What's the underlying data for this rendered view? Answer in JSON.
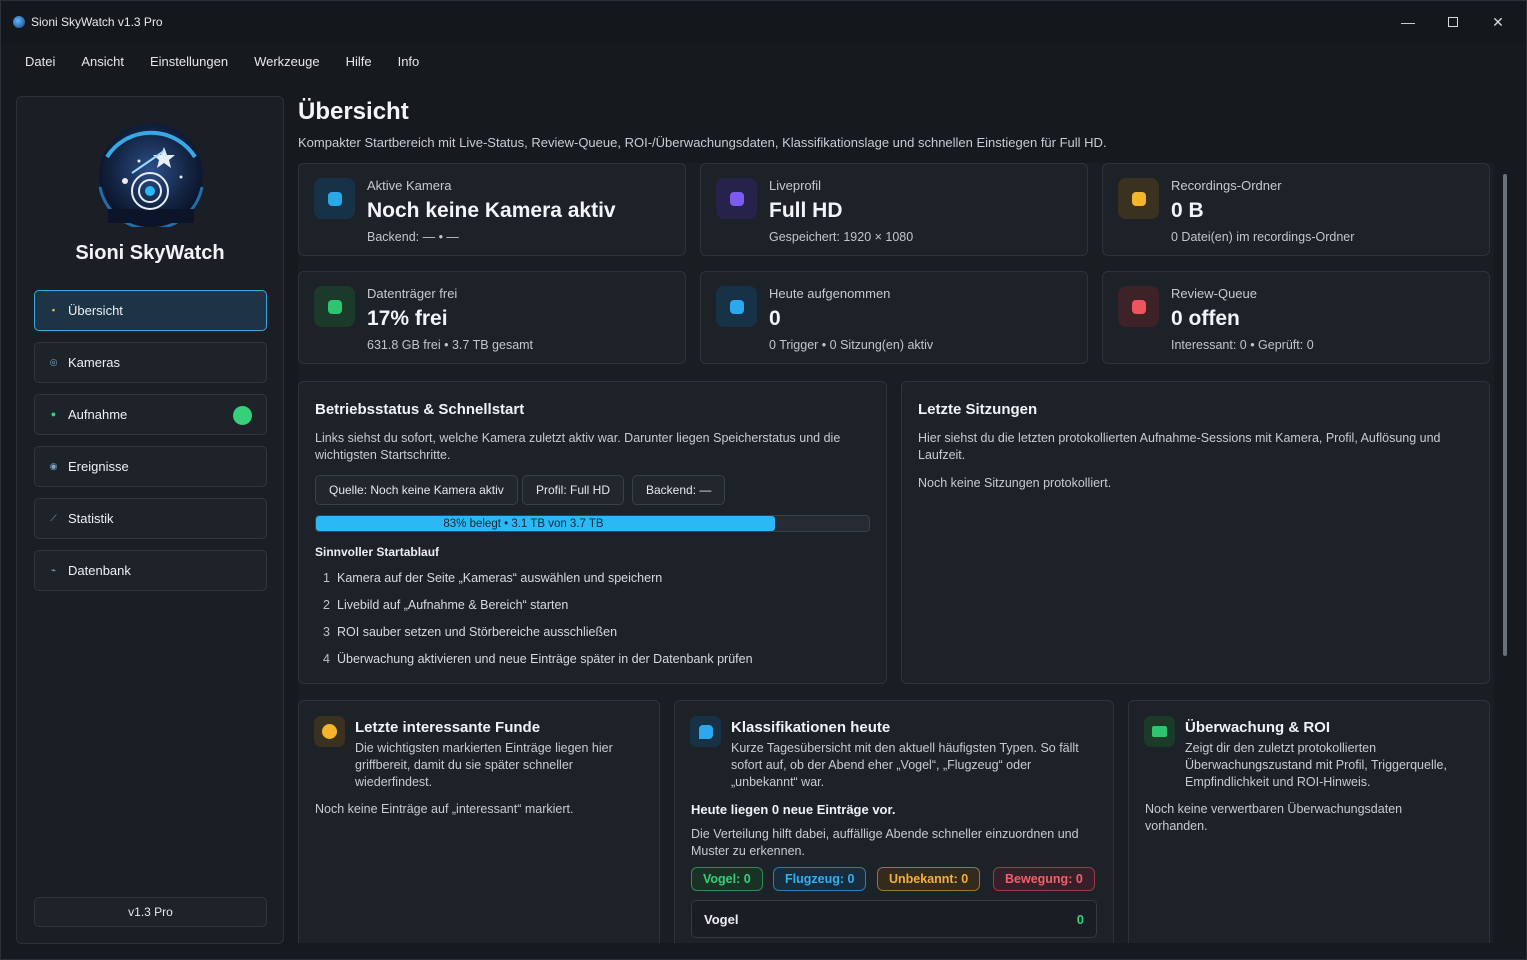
{
  "window": {
    "title": "Sioni SkyWatch v1.3 Pro"
  },
  "menu": [
    "Datei",
    "Ansicht",
    "Einstellungen",
    "Werkzeuge",
    "Hilfe",
    "Info"
  ],
  "sidebar": {
    "brand": "Sioni SkyWatch",
    "items": [
      {
        "label": "Übersicht",
        "icon": "grid-icon",
        "active": true
      },
      {
        "label": "Kameras",
        "icon": "camera-icon",
        "active": false
      },
      {
        "label": "Aufnahme",
        "icon": "record-icon",
        "active": false,
        "live": true
      },
      {
        "label": "Ereignisse",
        "icon": "events-icon",
        "active": false
      },
      {
        "label": "Statistik",
        "icon": "chart-icon",
        "active": false
      },
      {
        "label": "Datenbank",
        "icon": "database-icon",
        "active": false
      }
    ],
    "version": "v1.3 Pro"
  },
  "page": {
    "title": "Übersicht",
    "subtitle": "Kompakter Startbereich mit Live-Status, Review-Queue, ROI-/Überwachungsdaten, Klassifikationslage und schnellen Einstiegen für Full HD."
  },
  "stats": [
    {
      "label": "Aktive Kamera",
      "value": "Noch keine Kamera aktiv",
      "sub": "Backend: — • —",
      "color": "#29a9e8"
    },
    {
      "label": "Liveprofil",
      "value": "Full HD",
      "sub": "Gespeichert: 1920 × 1080",
      "color": "#7c5cf0"
    },
    {
      "label": "Recordings-Ordner",
      "value": "0 B",
      "sub": "0 Datei(en) im recordings-Ordner",
      "color": "#f2b52c"
    },
    {
      "label": "Datenträger frei",
      "value": "17% frei",
      "sub": "631.8 GB frei • 3.7 TB gesamt",
      "color": "#2fc46f"
    },
    {
      "label": "Heute aufgenommen",
      "value": "0",
      "sub": "0 Trigger • 0 Sitzung(en) aktiv",
      "color": "#2ba8ee"
    },
    {
      "label": "Review-Queue",
      "value": "0 offen",
      "sub": "Interessant: 0 • Geprüft: 0",
      "color": "#ec5560"
    }
  ],
  "status": {
    "title": "Betriebsstatus & Schnellstart",
    "text": "Links siehst du sofort, welche Kamera zuletzt aktiv war. Darunter liegen Speicherstatus und die wichtigsten Startschritte.",
    "chips": [
      "Quelle: Noch keine Kamera aktiv",
      "Profil: Full HD",
      "Backend: —"
    ],
    "progress_text": "83% belegt • 3.1 TB von 3.7 TB",
    "progress_value": 0.83,
    "steps_title": "Sinnvoller Startablauf",
    "steps": [
      {
        "num": "1",
        "text": "Kamera auf der Seite „Kameras“ auswählen und speichern"
      },
      {
        "num": "2",
        "text": "Livebild auf „Aufnahme & Bereich“ starten"
      },
      {
        "num": "3",
        "text": "ROI sauber setzen und Störbereiche ausschließen"
      },
      {
        "num": "4",
        "text": "Überwachung aktivieren und neue Einträge später in der Datenbank prüfen"
      }
    ]
  },
  "sessions": {
    "title": "Letzte Sitzungen",
    "text": "Hier siehst du die letzten protokollierten Aufnahme-Sessions mit Kamera, Profil, Auflösung und Laufzeit.",
    "empty": "Noch keine Sitzungen protokolliert."
  },
  "finds": {
    "title": "Letzte interessante Funde",
    "text": "Die wichtigsten markierten Einträge liegen hier griffbereit, damit du sie später schneller wiederfindest.",
    "empty": "Noch keine Einträge auf „interessant“ markiert."
  },
  "classes": {
    "title": "Klassifikationen heute",
    "text": "Kurze Tagesübersicht mit den aktuell häufigsten Typen. So fällt sofort auf, ob der Abend eher „Vogel“, „Flugzeug“ oder „unbekannt“ war.",
    "headline": "Heute liegen 0 neue Einträge vor.",
    "hint": "Die Verteilung hilft dabei, auffällige Abende schneller einzuordnen und Muster zu erkennen.",
    "badges": [
      {
        "label": "Vogel: 0",
        "color": "#35d07a"
      },
      {
        "label": "Flugzeug: 0",
        "color": "#2fb1f2"
      },
      {
        "label": "Unbekannt: 0",
        "color": "#f2b23a"
      },
      {
        "label": "Bewegung: 0",
        "color": "#f0606a"
      }
    ],
    "row_label": "Vogel",
    "row_value": "0"
  },
  "monitor": {
    "title": "Überwachung & ROI",
    "text": "Zeigt dir den zuletzt protokollierten Überwachungszustand mit Profil, Triggerquelle, Empfindlichkeit und ROI-Hinweis.",
    "empty": "Noch keine verwertbaren Überwachungsdaten vorhanden."
  }
}
